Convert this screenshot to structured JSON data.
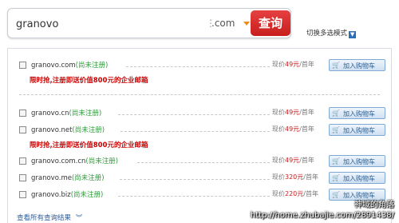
{
  "search": {
    "value": "granovo",
    "suffix": ".com",
    "button_label": "查询"
  },
  "toggle_mode": {
    "label": "切换多选模式",
    "icon": "chevron-down-icon"
  },
  "results": [
    {
      "domain": "granovo.com",
      "status": "(尚未注册)",
      "price_prefix": "现价",
      "price_amount": "49元",
      "price_suffix": "/首年",
      "cart_label": "加入购物车"
    },
    {
      "domain": "granovo.cn",
      "status": "(尚未注册)",
      "price_prefix": "现价",
      "price_amount": "49元",
      "price_suffix": "/首年",
      "cart_label": "加入购物车"
    },
    {
      "domain": "granovo.net",
      "status": "(尚未注册)",
      "price_prefix": "现价",
      "price_amount": "49元",
      "price_suffix": "/首年",
      "cart_label": "加入购物车"
    },
    {
      "domain": "granovo.com.cn",
      "status": "(尚未注册)",
      "price_prefix": "现价",
      "price_amount": "49元",
      "price_suffix": "/首年",
      "cart_label": "加入购物车"
    },
    {
      "domain": "granovo.me",
      "status": "(尚未注册)",
      "price_prefix": "现价",
      "price_amount": "320元",
      "price_suffix": "/首年",
      "cart_label": "加入购物车"
    },
    {
      "domain": "granovo.biz",
      "status": "(尚未注册)",
      "price_prefix": "现价",
      "price_amount": "220元",
      "price_suffix": "/首年",
      "cart_label": "加入购物车"
    }
  ],
  "promos": {
    "first": "限时抢,注册即送价值800元的企业邮箱",
    "second": "限时抢,注册即送价值800元的企业邮箱"
  },
  "more_results": {
    "label": "查看所有查询结果",
    "icon": "double-chevron-down-icon"
  },
  "watermark": {
    "line1": "神域的角落",
    "line2": "http://home.zhubajie.com/2891438/"
  },
  "colors": {
    "search_button": "#d62a2a",
    "status_green": "#2e9b3a",
    "promo_red": "#cc0000",
    "price_red": "#d02020",
    "cart_blue": "#2c5f93"
  }
}
